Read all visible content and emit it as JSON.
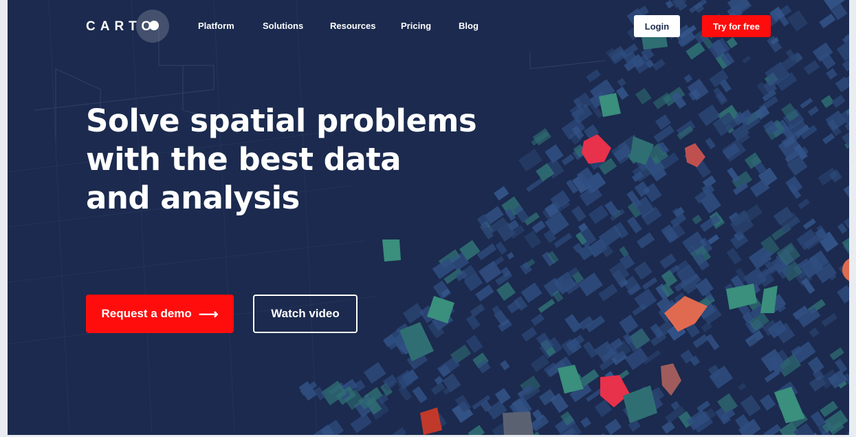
{
  "brand": {
    "logo_text": "CARTO"
  },
  "nav": {
    "items": [
      "Platform",
      "Solutions",
      "Resources",
      "Pricing",
      "Blog"
    ],
    "login_label": "Login",
    "try_label": "Try for free"
  },
  "hero": {
    "headline_lines": [
      "Solve spatial problems",
      "with the best data",
      "and analysis"
    ],
    "demo_label": "Request a demo",
    "demo_arrow": "⟶",
    "video_label": "Watch video"
  },
  "colors": {
    "background": "#1b2a4e",
    "accent_red": "#ff0d0d",
    "building_blue": "#2f4d80",
    "building_teal": "#2f6f73",
    "building_green": "#3a8f7d",
    "building_red": "#e8314b",
    "building_orange": "#e06a50"
  }
}
